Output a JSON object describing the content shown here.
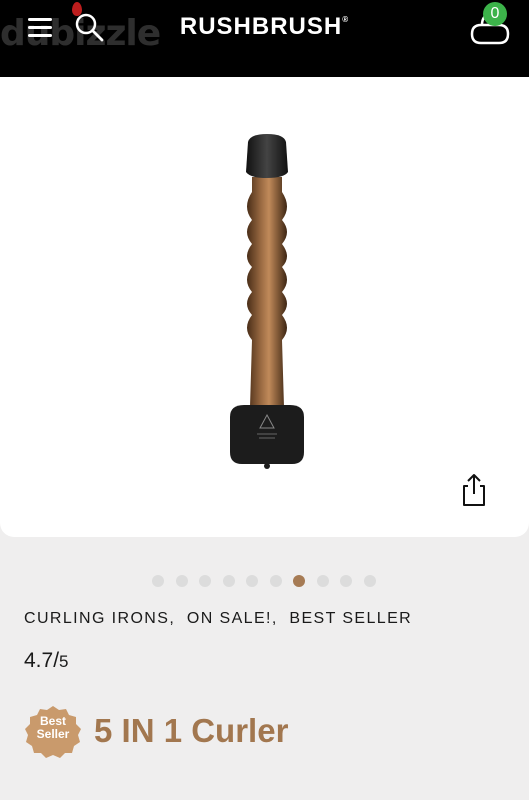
{
  "header": {
    "brand": "RUSHBRUSH",
    "brand_mark": "®",
    "cart_count": "0",
    "watermark": "dubizzle"
  },
  "gallery": {
    "total_images": 10,
    "active_index": 6
  },
  "product": {
    "categories": "CURLING IRONS,  ON SALE!,  BEST SELLER",
    "rating": "4.7/",
    "rating_max": "5",
    "badge_line1": "Best",
    "badge_line2": "Seller",
    "title": "5 IN 1 Curler"
  },
  "colors": {
    "accent": "#a2774f",
    "badge": "#c99a6c",
    "cart_badge": "#3cb34a",
    "header_bg": "#000000"
  }
}
